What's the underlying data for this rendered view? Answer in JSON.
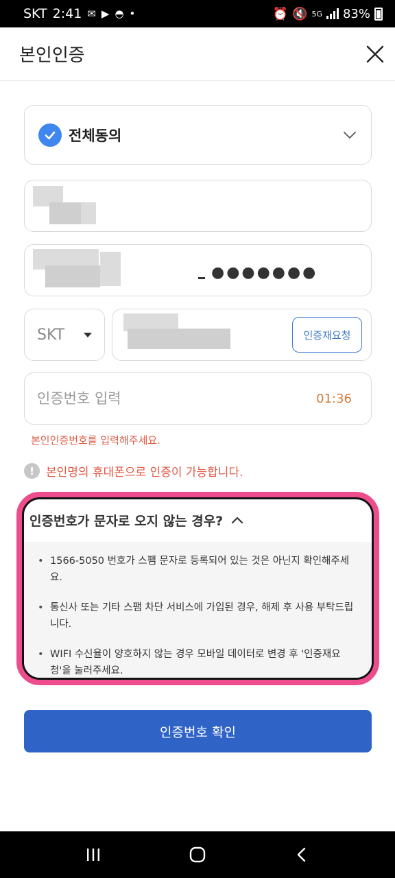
{
  "status_bar": {
    "carrier": "SKT",
    "time": "2:41",
    "network": "5G",
    "battery": "83%"
  },
  "header": {
    "title": "본인인증"
  },
  "agreement": {
    "label": "전체동의"
  },
  "carrier_select": {
    "value": "SKT"
  },
  "birth": {
    "masked_suffix": "●●●●●●●"
  },
  "phone": {
    "resend_label": "인증재요청"
  },
  "code": {
    "placeholder": "인증번호 입력",
    "timer": "01:36",
    "error": "본인인증번호를 입력해주세요."
  },
  "notice": {
    "icon_text": "!",
    "text": "본인명의 휴대폰으로 인증이 가능합니다."
  },
  "help": {
    "title": "인증번호가 문자로 오지 않는 경우?",
    "items": [
      "1566-5050 번호가 스팸 문자로 등록되어 있는 것은 아닌지 확인해주세요.",
      "통신사 또는 기타 스팸 차단 서비스에 가입된 경우, 해제 후 사용 부탁드립니다.",
      "WIFI 수신율이 양호하지 않는 경우 모바일 데이터로 변경 후 '인증재요청'을 눌러주세요."
    ]
  },
  "confirm": {
    "label": "인증번호 확인"
  },
  "colors": {
    "primary": "#2f63c6",
    "check": "#3f87ef",
    "error": "#e05a45",
    "timer": "#d27b38",
    "highlight": "#ee4d8d"
  }
}
